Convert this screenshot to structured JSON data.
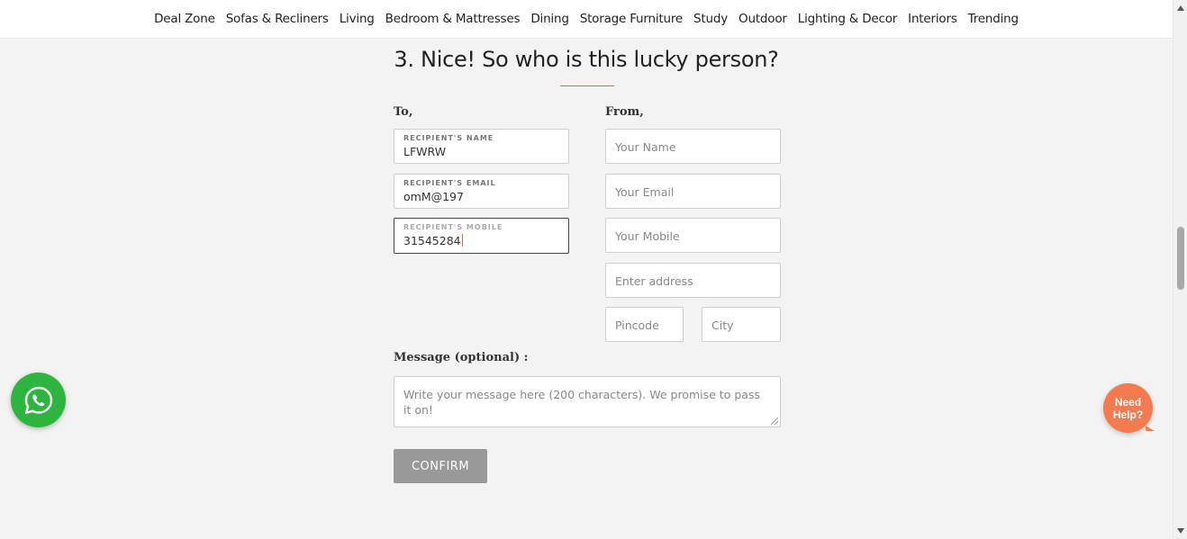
{
  "nav": {
    "items": [
      {
        "label": "Deal Zone"
      },
      {
        "label": "Sofas & Recliners"
      },
      {
        "label": "Living"
      },
      {
        "label": "Bedroom & Mattresses"
      },
      {
        "label": "Dining"
      },
      {
        "label": "Storage Furniture"
      },
      {
        "label": "Study"
      },
      {
        "label": "Outdoor"
      },
      {
        "label": "Lighting & Decor"
      },
      {
        "label": "Interiors"
      },
      {
        "label": "Trending"
      }
    ]
  },
  "heading": "3. Nice! So who is this lucky person?",
  "to": {
    "label": "To,",
    "recipient_name": {
      "label": "RECIPIENT'S NAME",
      "value": "LFWRW"
    },
    "recipient_email": {
      "label": "RECIPIENT'S EMAIL",
      "value": "omM@197"
    },
    "recipient_mobile": {
      "label": "RECIPIENT'S MOBILE",
      "value": "31545284"
    }
  },
  "from": {
    "label": "From,",
    "name_placeholder": "Your Name",
    "email_placeholder": "Your Email",
    "mobile_placeholder": "Your Mobile",
    "address_placeholder": "Enter address",
    "pincode_placeholder": "Pincode",
    "city_placeholder": "City"
  },
  "message": {
    "label": "Message (optional) :",
    "placeholder": "Write your message here (200 characters). We promise to pass it on!"
  },
  "confirm_label": "CONFIRM",
  "need_help": {
    "line1": "Need",
    "line2": "Help?"
  },
  "colors": {
    "accent": "#e5673f",
    "whatsapp": "#2eb540",
    "need_help": "#f47b4f",
    "confirm_bg": "#999999"
  },
  "icons": {
    "whatsapp": "whatsapp-icon"
  }
}
